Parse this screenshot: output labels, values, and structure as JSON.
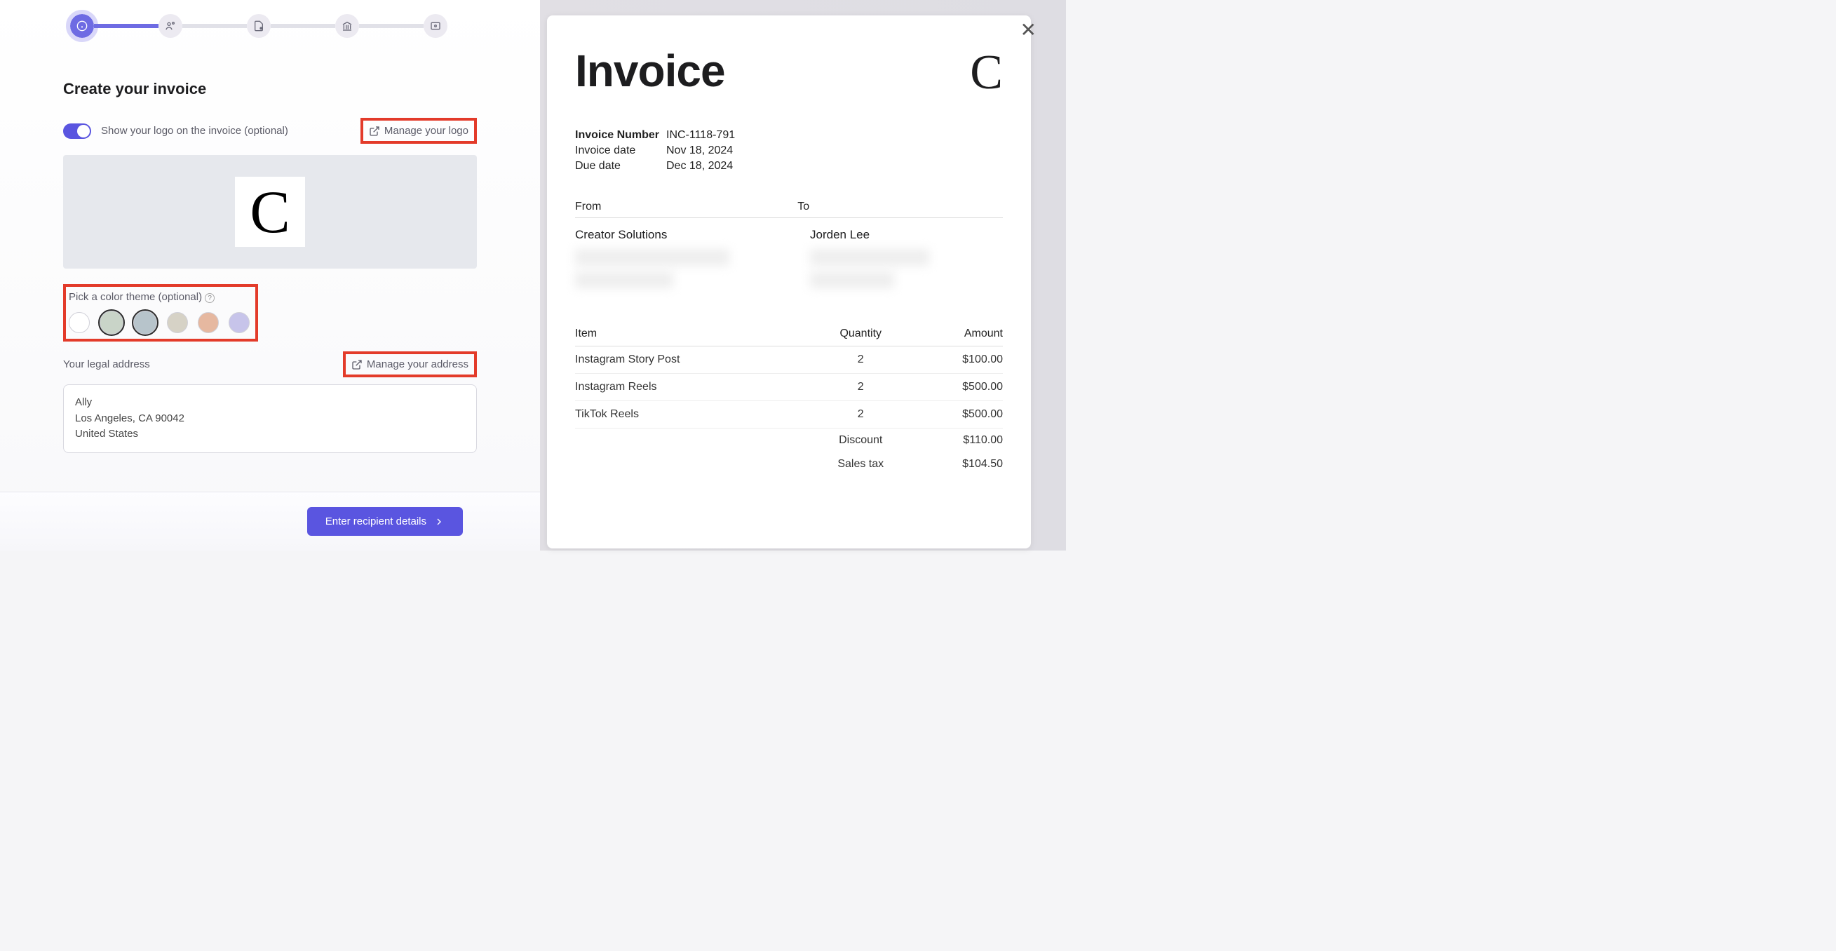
{
  "left": {
    "title": "Create your invoice",
    "show_logo_label": "Show your logo on the invoice (optional)",
    "manage_logo": "Manage your logo",
    "color_theme_label": "Pick a color theme (optional)",
    "address_label": "Your legal address",
    "manage_address": "Manage your address",
    "address_line1": "Ally",
    "address_line2": "Los Angeles, CA 90042",
    "address_line3": "United States",
    "next_button": "Enter recipient details",
    "swatches": [
      "#ffffff",
      "#c9d4c8",
      "#b7c4cb",
      "#d6d2c6",
      "#e6b8a0",
      "#c7c4ea"
    ]
  },
  "invoice": {
    "title": "Invoice",
    "number_label": "Invoice Number",
    "number": "INC-1118-791",
    "date_label": "Invoice date",
    "date": "Nov 18, 2024",
    "due_label": "Due date",
    "due": "Dec 18, 2024",
    "from_label": "From",
    "to_label": "To",
    "from_name": "Creator Solutions",
    "to_name": "Jorden Lee",
    "col_item": "Item",
    "col_qty": "Quantity",
    "col_amt": "Amount",
    "items": [
      {
        "name": "Instagram Story Post",
        "qty": "2",
        "amt": "$100.00"
      },
      {
        "name": "Instagram Reels",
        "qty": "2",
        "amt": "$500.00"
      },
      {
        "name": "TikTok Reels",
        "qty": "2",
        "amt": "$500.00"
      }
    ],
    "discount_label": "Discount",
    "discount": "$110.00",
    "tax_label": "Sales tax",
    "tax": "$104.50"
  }
}
